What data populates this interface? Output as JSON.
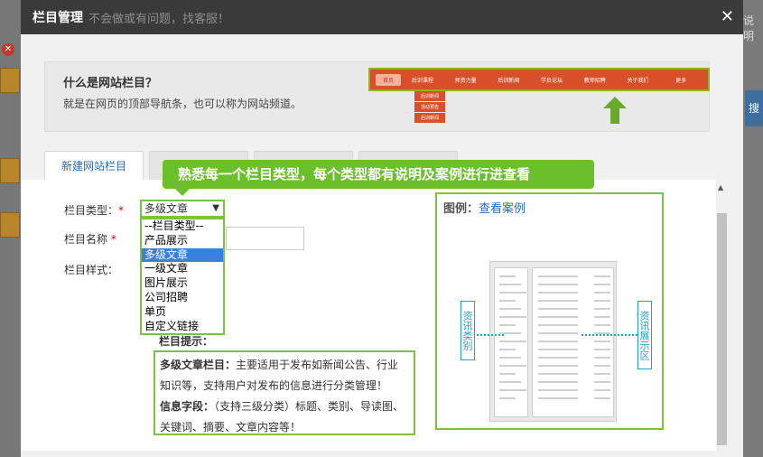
{
  "background": {
    "right_text": "说明",
    "right_button": "搜"
  },
  "dialog": {
    "title": "栏目管理",
    "subtitle": "不会做或有问题，找客服！",
    "close_label": "✕"
  },
  "intro": {
    "question": "什么是网站栏目？",
    "answer": "就是在网页的顶部导航条，也可以称为网站频道。",
    "nav_items": [
      "首页",
      "后训课程",
      "师资力量",
      "后训新闻",
      "学员论坛",
      "教师招聘",
      "关于我们",
      "更多"
    ],
    "sub_items": [
      "后训新闻",
      "活动预告",
      "后训新闻"
    ]
  },
  "tabs": [
    {
      "label": "新建网站栏目",
      "active": true
    },
    {
      "label": "",
      "active": false
    },
    {
      "label": "",
      "active": false
    },
    {
      "label": "",
      "active": false
    }
  ],
  "callout": "熟悉每一个栏目类型，每个类型都有说明及案例进行进查看",
  "form": {
    "type_label": "栏目类型：",
    "name_label": "栏目名称",
    "style_label": "栏目样式：",
    "required_mark": "*",
    "selected_type": "多级文章",
    "hint_title": "栏目提示：",
    "options": [
      "--栏目类型--",
      "产品展示",
      "多级文章",
      "一级文章",
      "图片展示",
      "公司招聘",
      "单页",
      "自定义链接"
    ],
    "selected_index": 2
  },
  "description": {
    "name_bold": "多级文章栏目：",
    "name_text": "主要适用于发布如新闻公告、行业知识等，支持用户对发布的信息进行分类管理！",
    "fields_bold": "信息字段：",
    "fields_text": "（支持三级分类）标题、类别、导读图、关键词、摘要、文章内容等！"
  },
  "example": {
    "title": "图例：",
    "link": "查看案例",
    "left_tag": "资讯类别",
    "right_tag": "资讯展示区"
  },
  "colors": {
    "accent_green": "#7cc044",
    "callout_green": "#6bbf2b",
    "nav_orange": "#d8502a",
    "link_blue": "#2a6bb3",
    "select_blue": "#3a7fe0",
    "header_dark": "#3a3a3a"
  }
}
